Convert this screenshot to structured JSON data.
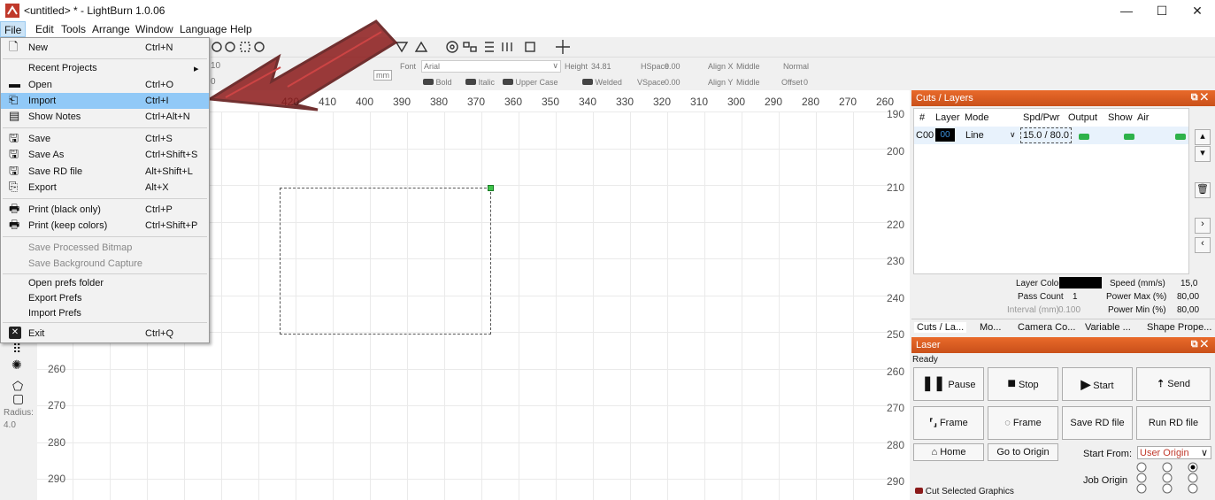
{
  "window": {
    "title": "<untitled> * - LightBurn 1.0.06",
    "minimize": "—",
    "maximize": "☐",
    "close": "✕"
  },
  "menubar": [
    "File",
    "Edit",
    "Tools",
    "Arrange",
    "Window",
    "Language",
    "Help"
  ],
  "file_menu": {
    "new": {
      "label": "New",
      "shortcut": "Ctrl+N"
    },
    "recent": {
      "label": "Recent Projects",
      "arrow": "▸"
    },
    "open": {
      "label": "Open",
      "shortcut": "Ctrl+O"
    },
    "import": {
      "label": "Import",
      "shortcut": "Ctrl+I"
    },
    "show_notes": {
      "label": "Show Notes",
      "shortcut": "Ctrl+Alt+N"
    },
    "save": {
      "label": "Save",
      "shortcut": "Ctrl+S"
    },
    "save_as": {
      "label": "Save As",
      "shortcut": "Ctrl+Shift+S"
    },
    "save_rd": {
      "label": "Save RD file",
      "shortcut": "Alt+Shift+L"
    },
    "export": {
      "label": "Export",
      "shortcut": "Alt+X"
    },
    "print_black": {
      "label": "Print (black only)",
      "shortcut": "Ctrl+P"
    },
    "print_colors": {
      "label": "Print (keep colors)",
      "shortcut": "Ctrl+Shift+P"
    },
    "save_bitmap": {
      "label": "Save Processed Bitmap"
    },
    "save_bg": {
      "label": "Save Background Capture"
    },
    "open_prefs": {
      "label": "Open prefs folder"
    },
    "export_prefs": {
      "label": "Export Prefs"
    },
    "import_prefs": {
      "label": "Import Prefs"
    },
    "exit": {
      "label": "Exit",
      "shortcut": "Ctrl+Q"
    }
  },
  "text_toolbar": {
    "font_label": "Font",
    "font_value": "Arial",
    "height_label": "Height",
    "height_value": "34.81",
    "hspace_label": "HSpace",
    "hspace_value": "0.00",
    "vspace_label": "VSpace",
    "vspace_value": "0.00",
    "alignx_label": "Align X",
    "alignx_value": "Middle",
    "aligny_label": "Align Y",
    "aligny_value": "Middle",
    "style_value": "Normal",
    "offset_label": "Offset",
    "offset_value": "0",
    "bold": "Bold",
    "italic": "Italic",
    "upper": "Upper Case",
    "welded": "Welded",
    "unit": "mm",
    "partial_a": "10",
    "partial_b": "0"
  },
  "ruler_top": [
    "420",
    "410",
    "400",
    "390",
    "380",
    "370",
    "360",
    "350",
    "340",
    "330",
    "320",
    "310",
    "300",
    "290",
    "280",
    "270",
    "260"
  ],
  "ruler_left": [
    "260",
    "270",
    "280",
    "290"
  ],
  "ruler_right": [
    "190",
    "200",
    "210",
    "220",
    "230",
    "240",
    "250",
    "260",
    "270",
    "280",
    "290"
  ],
  "left_tools": {
    "radius_label": "Radius:",
    "radius_value": "4.0"
  },
  "cuts_panel": {
    "title": "Cuts / Layers",
    "headers": [
      "#",
      "Layer",
      "Mode",
      "Spd/Pwr",
      "Output",
      "Show",
      "Air"
    ],
    "row": {
      "num": "C00",
      "layer": "00",
      "mode": "Line",
      "spdpwr": "15.0 / 80.0"
    },
    "layer_color_label": "Layer Color",
    "speed_label": "Speed (mm/s)",
    "speed_value": "15,0",
    "pass_label": "Pass Count",
    "pass_value": "1",
    "pmax_label": "Power Max (%)",
    "pmax_value": "80,00",
    "interval_label": "Interval (mm)",
    "interval_value": "0.100",
    "pmin_label": "Power Min (%)",
    "pmin_value": "80,00",
    "tabs": [
      "Cuts / La...",
      "Mo...",
      "Camera Co...",
      "Variable ...",
      "Shape Prope..."
    ]
  },
  "laser_panel": {
    "title": "Laser",
    "status": "Ready",
    "pause": "Pause",
    "stop": "Stop",
    "start": "Start",
    "send": "Send",
    "frame1": "Frame",
    "frame2": "Frame",
    "save_rd": "Save RD file",
    "run_rd": "Run RD file",
    "home": "Home",
    "goto_origin": "Go to Origin",
    "start_from_label": "Start From:",
    "start_from_value": "User Origin",
    "job_origin_label": "Job Origin",
    "cut_selected": "Cut Selected Graphics"
  },
  "colors": {
    "accent": "#e46a2a",
    "highlight": "#91c9f7",
    "arrow": "#8b1a1a"
  }
}
